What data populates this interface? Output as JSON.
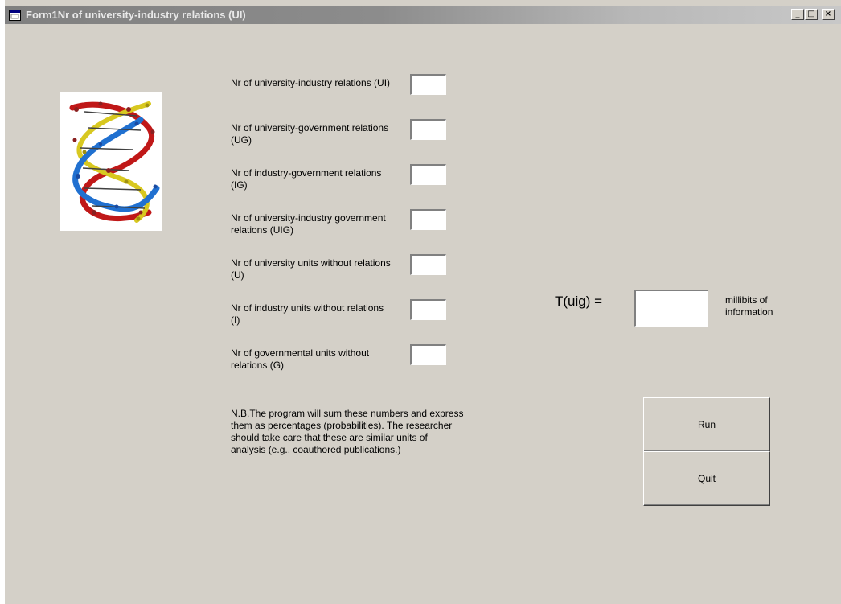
{
  "window": {
    "title": "Form1Nr of university-industry relations (UI)",
    "minimize_glyph": "_",
    "maximize_glyph": "□",
    "close_glyph": "×"
  },
  "fields": [
    {
      "label": "Nr of university-industry relations (UI)",
      "value": ""
    },
    {
      "label": "Nr of university-government relations (UG)",
      "value": ""
    },
    {
      "label": "Nr of industry-government relations (IG)",
      "value": ""
    },
    {
      "label": "Nr of university-industry government relations (UIG)",
      "value": ""
    },
    {
      "label": "Nr of university units without relations (U)",
      "value": ""
    },
    {
      "label": "Nr of industry units without relations (I)",
      "value": ""
    },
    {
      "label": "Nr of governmental units without relations (G)",
      "value": ""
    }
  ],
  "note": "N.B.The program will sum these numbers and express them as percentages (probabilities). The researcher should take care that these are similar units of analysis (e.g., coauthored publications.)",
  "result": {
    "label": "T(uig) =",
    "value": "",
    "unit": "millibits of information"
  },
  "buttons": {
    "run": "Run",
    "quit": "Quit"
  },
  "icons": {
    "app": "window-icon",
    "image": "dna-double-helix-image"
  }
}
